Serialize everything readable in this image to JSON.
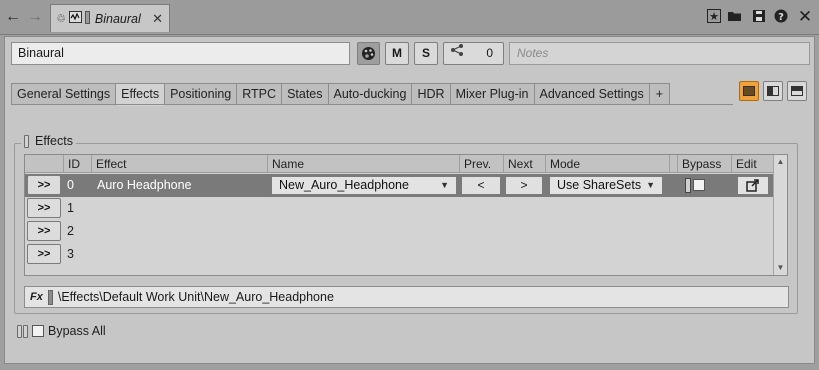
{
  "window": {
    "object_name": "Binaural",
    "tab_title": "Binaural"
  },
  "toolbar": {
    "mute_label": "M",
    "solo_label": "S",
    "share_count": "0",
    "notes_placeholder": "Notes"
  },
  "tabs": [
    {
      "label": "General Settings",
      "active": false
    },
    {
      "label": "Effects",
      "active": true
    },
    {
      "label": "Positioning",
      "active": false
    },
    {
      "label": "RTPC",
      "active": false
    },
    {
      "label": "States",
      "active": false
    },
    {
      "label": "Auto-ducking",
      "active": false
    },
    {
      "label": "HDR",
      "active": false
    },
    {
      "label": "Mixer Plug-in",
      "active": false
    },
    {
      "label": "Advanced Settings",
      "active": false
    },
    {
      "label": "+",
      "active": false
    }
  ],
  "effects": {
    "group_label": "Effects",
    "columns": {
      "id": "ID",
      "effect": "Effect",
      "name": "Name",
      "prev": "Prev.",
      "next": "Next",
      "mode": "Mode",
      "bypass": "Bypass",
      "edit": "Edit"
    },
    "expand_label": ">>",
    "prev_label": "<",
    "next_label": ">",
    "rows": [
      {
        "id": "0",
        "effect": "Auro Headphone",
        "name": "New_Auro_Headphone",
        "mode": "Use ShareSets",
        "selected": true
      },
      {
        "id": "1"
      },
      {
        "id": "2"
      },
      {
        "id": "3"
      }
    ],
    "path": "\\Effects\\Default Work Unit\\New_Auro_Headphone",
    "fx_label": "Fx"
  },
  "bypass_all_label": "Bypass All",
  "colors": {
    "accent": "#f0a23a",
    "selected_row": "#7a7a7a",
    "panel": "#c6c6c6"
  }
}
